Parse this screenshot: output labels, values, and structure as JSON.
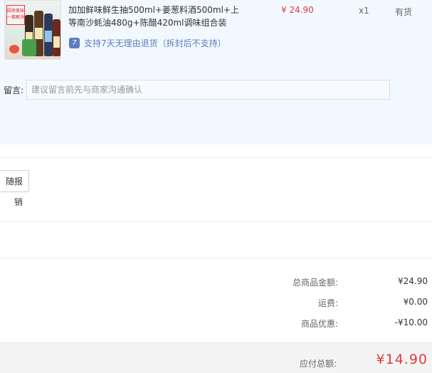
{
  "product": {
    "title": "加加鲜味鲜生抽500ml+姜葱料酒500ml+上等南沙蚝油480g+陈醋420ml调味组合装",
    "price": "¥ 24.90",
    "quantity": "x1",
    "stock": "有货",
    "return_icon_glyph": "7",
    "return_policy": "支持7天无理由退货（拆封后不支持）",
    "image_badge": "厨房美味一套解决"
  },
  "message": {
    "label": "留言:",
    "placeholder": "建议留言前先与商家沟通确认"
  },
  "invoice": {
    "button_label": "随报销"
  },
  "summary": {
    "total_goods_label": "总商品金额:",
    "total_goods_value": "¥24.90",
    "shipping_label": "运费:",
    "shipping_value": "¥0.00",
    "discount_label": "商品优惠:",
    "discount_value": "-¥10.00",
    "payable_label": "应付总额:",
    "payable_value": "¥14.90"
  },
  "colors": {
    "price_red": "#e4393c",
    "panel_blue": "#f2f8ff",
    "link_blue": "#5e7dbb"
  }
}
